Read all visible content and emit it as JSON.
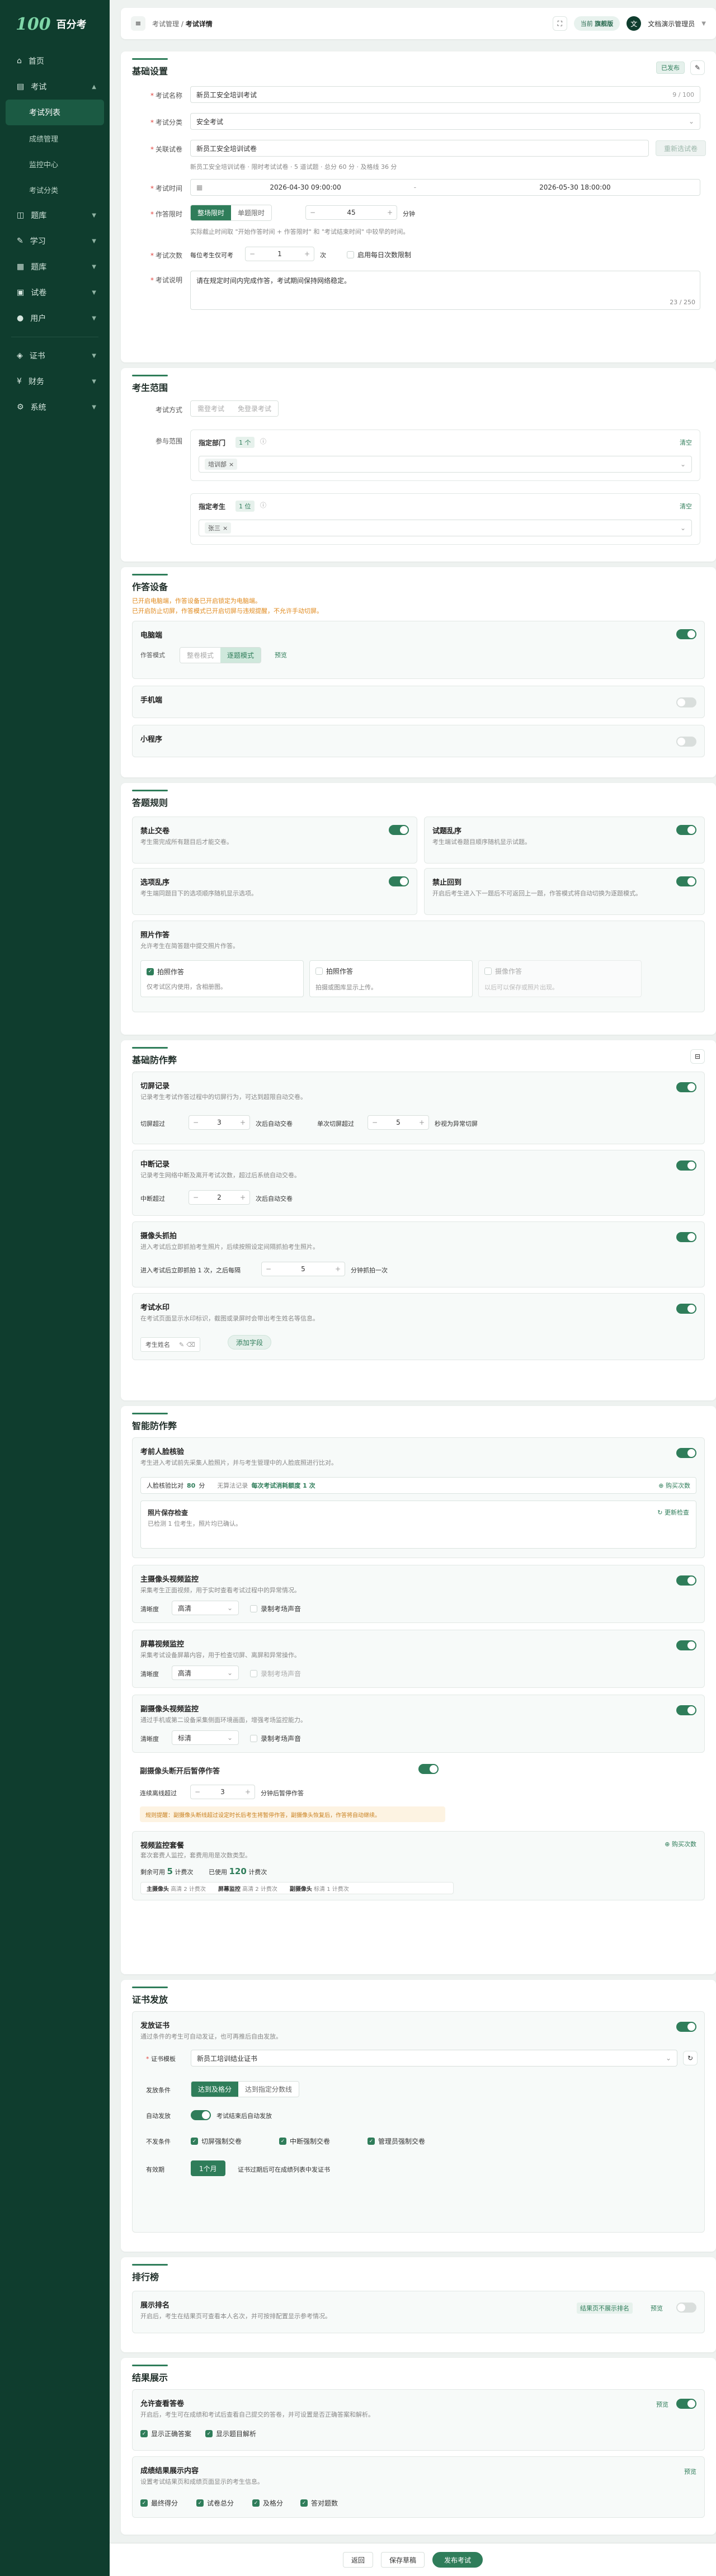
{
  "sidebar": {
    "logo_mark": "100",
    "brand": "百分考",
    "items": [
      {
        "label": "首页",
        "icon": "home-icon"
      },
      {
        "label": "考试",
        "icon": "exam-icon"
      },
      {
        "label": "考试列表"
      },
      {
        "label": "成绩管理"
      },
      {
        "label": "监控中心"
      },
      {
        "label": "考试分类"
      },
      {
        "label": "题库",
        "icon": "question-bank-icon"
      },
      {
        "label": "学习",
        "icon": "learn-icon"
      },
      {
        "label": "题库",
        "icon": "library-icon"
      },
      {
        "label": "试卷",
        "icon": "paper-icon"
      },
      {
        "label": "用户",
        "icon": "user-icon"
      },
      {
        "label": "证书",
        "icon": "certificate-icon"
      },
      {
        "label": "财务",
        "icon": "finance-icon"
      },
      {
        "label": "系统",
        "icon": "gear-icon"
      }
    ]
  },
  "topbar": {
    "crumb1": "考试管理",
    "crumb2": "考试详情",
    "chip_prefix": "当前",
    "chip": "旗舰版",
    "user": "文档演示管理员"
  },
  "basic": {
    "title": "基础设置",
    "tag": "已发布",
    "name_label": "考试名称",
    "name_value": "新员工安全培训考试",
    "name_count": "9 / 100",
    "cat_label": "考试分类",
    "cat_value": "安全考试",
    "paper_label": "关联试卷",
    "paper_value": "新员工安全培训试卷",
    "paper_btn": "重新选试卷",
    "paper_hint": "新员工安全培训试卷 · 限时考试试卷 · 5 道试题 · 总分 60 分 · 及格线 36 分",
    "time_label": "考试时间",
    "time_start": "2026-04-30 09:00:00",
    "time_sep": "-",
    "time_end": "2026-05-30 18:00:00",
    "limit_label": "作答限时",
    "limit_on": "整场限时",
    "limit_off": "单题限时",
    "limit_value": "45",
    "limit_unit": "分钟",
    "limit_hint": "实际截止时间取 \"开始作答时间 + 作答限时\" 和 \"考试结束时间\" 中较早的时间。",
    "times_label": "考试次数",
    "times_prefix": "每位考生仅可考",
    "times_value": "1",
    "times_unit": "次",
    "times_opt": "启用每日次数限制",
    "desc_label": "考试说明",
    "desc_value": "请在规定时间内完成作答，考试期间保持网络稳定。",
    "desc_count": "23 / 250"
  },
  "scope": {
    "title": "考生范围",
    "mode_label": "考试方式",
    "mode1": "需登考试",
    "mode2": "免登录考试",
    "range_label": "参与范围",
    "dept_title": "指定部门",
    "dept_count": "1 个",
    "dept_clear": "清空",
    "dept_tag": "培训部",
    "user_title": "指定考生",
    "user_count": "1 位",
    "user_clear": "清空",
    "user_tag": "张三"
  },
  "answer": {
    "title": "作答设备",
    "warn1": "已开启电脑端，作答设备已开启锁定为电脑端。",
    "warn2": "已开启防止切屏，作答模式已开启切屏与违规提醒，不允许手动切屏。",
    "pc": "电脑端",
    "mode_label": "作答模式",
    "mode1": "整卷模式",
    "mode2": "逐题模式",
    "preview": "预览",
    "mobile": "手机端",
    "mini": "小程序"
  },
  "rules": {
    "title": "答题规则",
    "r1_t": "禁止交卷",
    "r1_d": "考生需完成所有题目后才能交卷。",
    "r2_t": "试题乱序",
    "r2_d": "考生端试卷题目顺序随机显示试题。",
    "r3_t": "选项乱序",
    "r3_d": "考生端同题目下的选项顺序随机显示选项。",
    "r4_t": "禁止回到",
    "r4_d": "开启后考生进入下一题后不可返回上一题，作答模式将自动切换为逐题模式。",
    "photo_t": "照片作答",
    "photo_d": "允许考生在简答题中提交照片作答。",
    "p1_t": "拍照作答",
    "p1_d": "仅考试区内使用，含相册图。",
    "p2_t": "拍照作答",
    "p2_d": "拍摄或图库显示上传。",
    "p3_t": "摄像作答",
    "p3_d": "以后可以保存或照片出现。"
  },
  "anti": {
    "title": "基础防作弊",
    "s1_t": "切屏记录",
    "s1_d": "记录考生考试作答过程中的切屏行为，可达到超限自动交卷。",
    "s1_a": "切屏超过",
    "s1_a_v": "3",
    "s1_a_u": "次后自动交卷",
    "s1_b": "单次切屏超过",
    "s1_b_v": "5",
    "s1_b_u": "秒视为异常切屏",
    "s2_t": "中断记录",
    "s2_d": "记录考生网络中断及离开考试次数，超过后系统自动交卷。",
    "s2_a": "中断超过",
    "s2_a_v": "2",
    "s2_a_u": "次后自动交卷",
    "s3_t": "摄像头抓拍",
    "s3_d": "进入考试后立即抓拍考生照片，后续按照设定间隔抓拍考生照片。",
    "s3_a": "进入考试后立即抓拍 1 次，之后每隔",
    "s3_a_v": "5",
    "s3_a_u": "分钟抓拍一次",
    "s4_t": "考试水印",
    "s4_d": "在考试页面显示水印标识，截图或录屏时会带出考生姓名等信息。",
    "s4_tag": "考生姓名",
    "s4_add": "添加字段"
  },
  "smart": {
    "title": "智能防作弊",
    "face_t": "考前人脸核验",
    "face_d": "考生进入考试前先采集人脸照片，并与考生管理中的人脸底照进行比对。",
    "face_pass": "人脸核验比对",
    "face_pass_v": "80",
    "face_pass_u": "分",
    "face_more": "无算法记录",
    "face_more_v": "每次考试消耗额度 1 次",
    "face_buy": "购买次数",
    "photo_t": "照片保存检查",
    "photo_d": "已检测 1 位考生，照片均已确认。",
    "photo_btn": "更新检查",
    "mc_t": "主摄像头视频监控",
    "mc_d": "采集考生正面视频，用于实时查看考试过程中的异常情况。",
    "mc_q": "清晰度",
    "mc_q_v": "高清",
    "mc_opt": "录制考场声音",
    "sc_t": "屏幕视频监控",
    "sc_d": "采集考试设备屏幕内容，用于检查切屏、离屏和异常操作。",
    "sc_q": "清晰度",
    "sc_q_v": "高清",
    "sc_opt": "录制考场声音",
    "vc_t": "副摄像头视频监控",
    "vc_d": "通过手机或第二设备采集侧面环境画面，增强考场监控能力。",
    "vc_q": "清晰度",
    "vc_q_v": "标清",
    "vc_opt": "录制考场声音",
    "off_t": "副摄像头断开后暂停作答",
    "off_a": "连续离线超过",
    "off_v": "3",
    "off_u": "分钟后暂停作答",
    "off_warn": "规则提醒：副摄像头断线超过设定时长后考生将暂停作答，副摄像头恢复后，作答将自动继续。",
    "pkg_t": "视频监控套餐",
    "pkg_d": "套次套费人监控，套费用用是次数类型。",
    "pkg_buy": "购买次数",
    "pkg_left": "剩余可用",
    "pkg_left_v": "5",
    "pkg_left_u": "计费次",
    "pkg_used": "已使用",
    "pkg_used_v": "120",
    "pkg_used_u": "计费次",
    "pkg_r1": "主摄像头",
    "pkg_r1_a": "高清 2 计费次",
    "pkg_r2": "屏幕监控",
    "pkg_r2_a": "高清 2 计费次",
    "pkg_r3": "副摄像头",
    "pkg_r3_a": "标清 1 计费次"
  },
  "cert": {
    "title": "证书发放",
    "s_t": "发放证书",
    "s_d": "通过条件的考生可自动发证，也可再推后自由发放。",
    "tpl_label": "证书模板",
    "tpl_value": "新员工培训结业证书",
    "cond_label": "发放条件",
    "cond1": "达到及格分",
    "cond2": "达到指定分数线",
    "auto_label": "自动发放",
    "auto_d": "考试结束后自动发放",
    "ex_label": "不发条件",
    "ex1": "切屏强制交卷",
    "ex2": "中断强制交卷",
    "ex3": "管理员强制交卷",
    "valid_label": "有效期",
    "valid_v": "1个月",
    "valid_d": "证书过期后可在成绩列表中发证书"
  },
  "rank": {
    "title": "排行榜",
    "t": "展示排名",
    "d": "开启后，考生在结果页可查看本人名次，并可按排配置显示参考情况。",
    "tag": "结果页不展示排名",
    "preview": "预览"
  },
  "result": {
    "title": "结果展示",
    "a_t": "允许查看答卷",
    "a_d": "开启后，考生可在成绩和考试后查看自己提交的答卷，并可设置是否正确答案和解析。",
    "a_pv": "预览",
    "a_c1": "显示正确答案",
    "a_c2": "显示题目解析",
    "b_t": "成绩结果展示内容",
    "b_d": "设置考试结果页和成绩页面显示的考生信息。",
    "b_pv": "预览",
    "b_c1": "最终得分",
    "b_c2": "试卷总分",
    "b_c3": "及格分",
    "b_c4": "答对题数"
  },
  "footer": {
    "back": "返回",
    "save": "保存草稿",
    "publish": "发布考试"
  }
}
